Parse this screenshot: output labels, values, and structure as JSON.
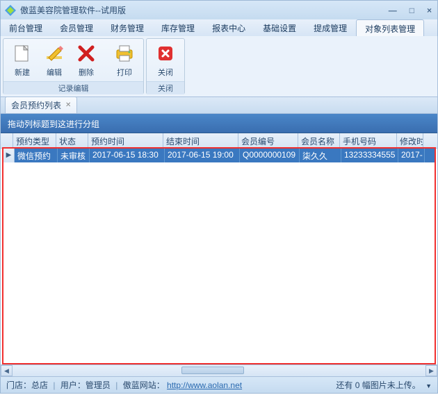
{
  "window": {
    "title": "傲蓝美容院管理软件--试用版"
  },
  "menu": {
    "items": [
      "前台管理",
      "会员管理",
      "财务管理",
      "库存管理",
      "报表中心",
      "基础设置",
      "提成管理",
      "对象列表管理"
    ],
    "active_index": 7
  },
  "ribbon": {
    "group_edit": {
      "title": "记录编辑",
      "new": "新建",
      "edit": "编辑",
      "delete": "删除"
    },
    "group_print": {
      "title": "",
      "print": "打印"
    },
    "group_close": {
      "title": "关闭",
      "close": "关闭"
    }
  },
  "tab": {
    "label": "会员预约列表"
  },
  "grid": {
    "group_hint": "拖动列标题到这进行分组",
    "columns": [
      "预约类型",
      "状态",
      "预约时间",
      "结束时间",
      "会员编号",
      "会员名称",
      "手机号码",
      "修改时"
    ],
    "rows": [
      {
        "cells": [
          "微信预约",
          "未审核",
          "2017-06-15 18:30",
          "2017-06-15 19:00",
          "Q0000000109",
          "柒久久",
          "13233334555",
          "2017-"
        ]
      }
    ]
  },
  "status": {
    "store_label": "门店：",
    "store": "总店",
    "user_label": "用户：",
    "user": "管理员",
    "site_label": "傲蓝网站：",
    "site_url": "http://www.aolan.net",
    "upload_hint": "还有 0 幅图片未上传。"
  }
}
